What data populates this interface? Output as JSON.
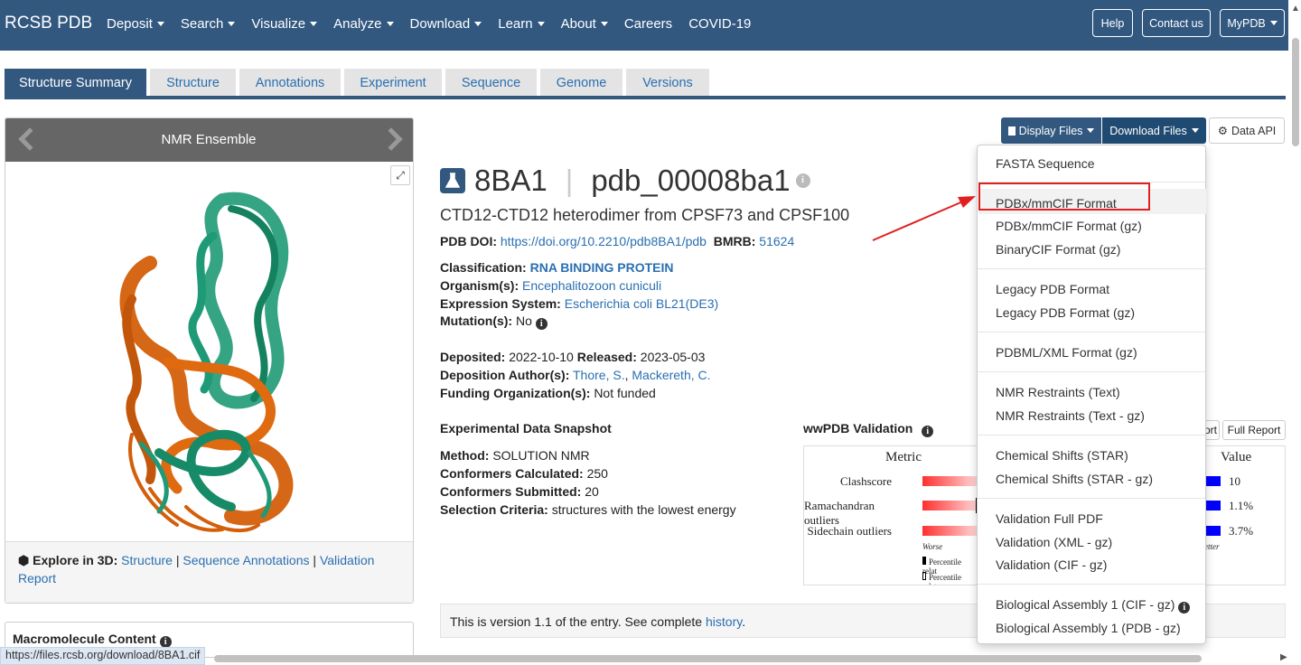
{
  "brand": "RCSB PDB",
  "nav": {
    "items": [
      {
        "label": "Deposit",
        "dropdown": true
      },
      {
        "label": "Search",
        "dropdown": true
      },
      {
        "label": "Visualize",
        "dropdown": true
      },
      {
        "label": "Analyze",
        "dropdown": true
      },
      {
        "label": "Download",
        "dropdown": true
      },
      {
        "label": "Learn",
        "dropdown": true
      },
      {
        "label": "About",
        "dropdown": true
      },
      {
        "label": "Careers",
        "dropdown": false
      },
      {
        "label": "COVID-19",
        "dropdown": false
      }
    ],
    "help": "Help",
    "contact": "Contact us",
    "mypdb": "MyPDB"
  },
  "tabs": [
    "Structure Summary",
    "Structure",
    "Annotations",
    "Experiment",
    "Sequence",
    "Genome",
    "Versions"
  ],
  "viewer": {
    "title": "NMR Ensemble",
    "explore_label": "Explore in 3D:",
    "explore_links": [
      "Structure",
      "Sequence Annotations",
      "Validation Report"
    ]
  },
  "macro_heading": "Macromolecule Content",
  "toolbar": {
    "display_files": "Display Files",
    "download_files": "Download Files",
    "data_api": "Data API"
  },
  "entry": {
    "id": "8BA1",
    "pdb_id": "pdb_00008ba1",
    "title": "CTD12-CTD12 heterodimer from CPSF73 and CPSF100",
    "doi_label": "PDB DOI:",
    "doi": "https://doi.org/10.2210/pdb8BA1/pdb",
    "bmrb_label": "BMRB:",
    "bmrb": "51624",
    "classification_label": "Classification:",
    "classification": "RNA BINDING PROTEIN",
    "organism_label": "Organism(s):",
    "organism": "Encephalitozoon cuniculi",
    "expression_label": "Expression System:",
    "expression": "Escherichia coli BL21(DE3)",
    "mutation_label": "Mutation(s):",
    "mutation": "No",
    "deposited_label": "Deposited:",
    "deposited": "2022-10-10",
    "released_label": "Released:",
    "released": "2023-05-03",
    "authors_label": "Deposition Author(s):",
    "authors": [
      "Thore, S.",
      "Mackereth, C."
    ],
    "funding_label": "Funding Organization(s):",
    "funding": "Not funded"
  },
  "snapshot": {
    "heading": "Experimental Data Snapshot",
    "method_label": "Method:",
    "method": "SOLUTION NMR",
    "calc_label": "Conformers Calculated:",
    "calc": "250",
    "sub_label": "Conformers Submitted:",
    "sub": "20",
    "crit_label": "Selection Criteria:",
    "crit": "structures with the lowest energy"
  },
  "validation": {
    "heading": "wwPDB Validation",
    "full_report": "Full Report",
    "report_partial": "ort",
    "metric_header": "Metric",
    "value_header": "Value",
    "metrics": [
      {
        "name": "Clashscore",
        "value": "10"
      },
      {
        "name": "Ramachandran outliers",
        "value": "1.1%"
      },
      {
        "name": "Sidechain outliers",
        "value": "3.7%"
      }
    ],
    "worse": "Worse",
    "better_partial": "etter",
    "legend_1": "Percentile relat",
    "legend_2": "Percentile relat",
    "colors": {
      "worse": "#ff0000",
      "better": "#0000ff"
    }
  },
  "version_text_prefix": "This is version 1.1 of the entry. See complete",
  "version_link": "history",
  "dropdown": {
    "groups": [
      [
        "FASTA Sequence"
      ],
      [
        "PDBx/mmCIF Format",
        "PDBx/mmCIF Format (gz)",
        "BinaryCIF Format (gz)"
      ],
      [
        "Legacy PDB Format",
        "Legacy PDB Format (gz)"
      ],
      [
        "PDBML/XML Format (gz)"
      ],
      [
        "NMR Restraints (Text)",
        "NMR Restraints (Text - gz)"
      ],
      [
        "Chemical Shifts (STAR)",
        "Chemical Shifts (STAR - gz)"
      ],
      [
        "Validation Full PDF",
        "Validation (XML - gz)",
        "Validation (CIF - gz)"
      ],
      [
        "Biological Assembly 1 (CIF - gz)",
        "Biological Assembly 1 (PDB - gz)"
      ]
    ],
    "highlighted": "PDBx/mmCIF Format"
  },
  "status_url": "https://files.rcsb.org/download/8BA1.cif",
  "colors": {
    "nav": "#325880",
    "link": "#2a6fb0",
    "annotation": "#e02020"
  }
}
